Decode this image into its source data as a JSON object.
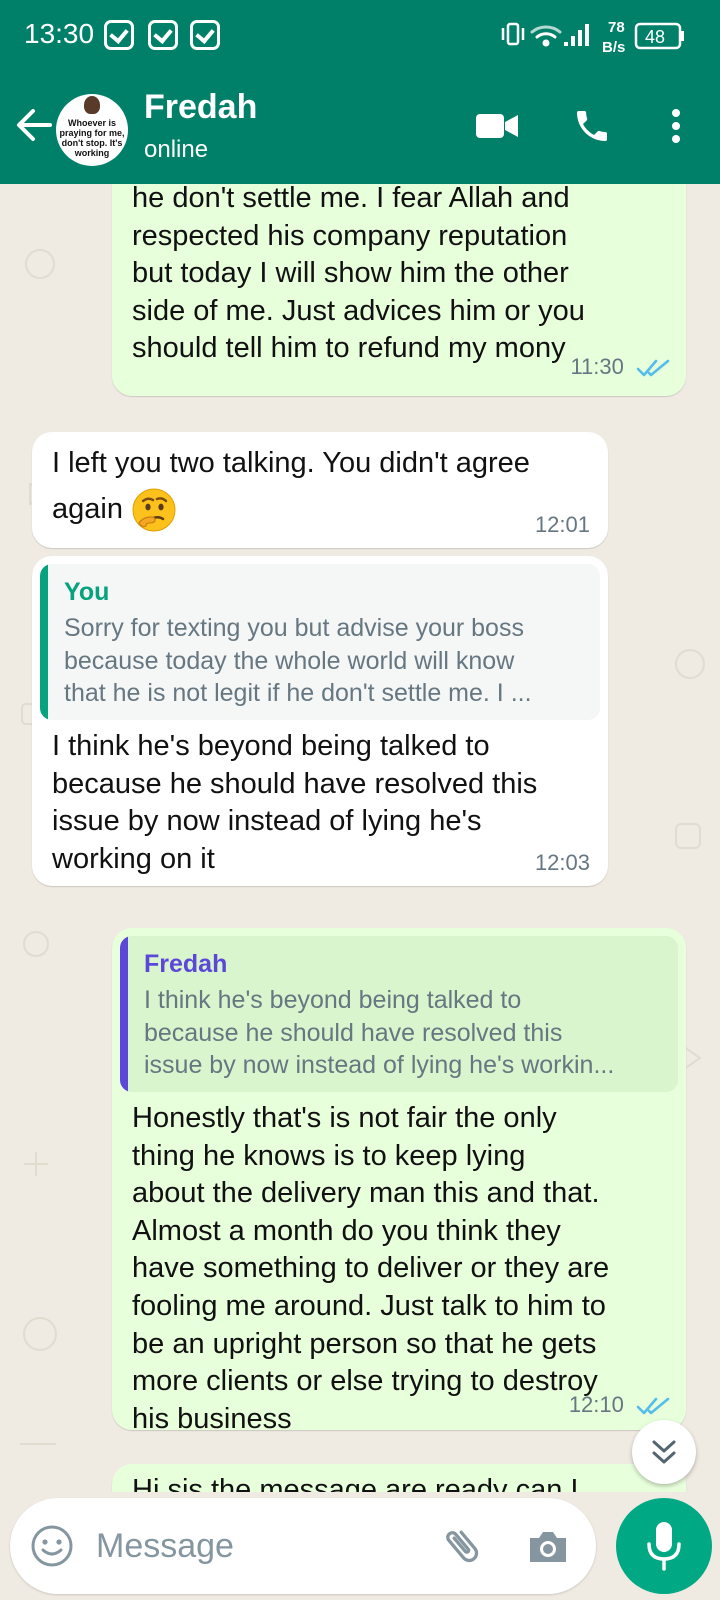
{
  "status_bar": {
    "time": "13:30",
    "network_speed_value": "78",
    "network_speed_unit": "B/s",
    "battery": "48"
  },
  "header": {
    "contact_name": "Fredah",
    "contact_status": "online",
    "avatar_text": "Whoever is praying for me, don't stop. It's working"
  },
  "messages": [
    {
      "direction": "outgoing",
      "lines": [
        "he don't settle me. I fear Allah and",
        "respected his company reputation",
        "but today I will show him the other",
        "side of me. Just advices him or you",
        "should tell him to refund my mony"
      ],
      "time": "11:30",
      "status": "read"
    },
    {
      "direction": "incoming",
      "lines": [
        "I left you two talking. You didn't agree",
        "again"
      ],
      "emoji": "thinking-face",
      "time": "12:01"
    },
    {
      "direction": "incoming",
      "quote": {
        "author": "You",
        "lines": [
          "Sorry for texting you but advise your boss",
          "because today the whole world will know",
          "that he is not legit if he don't settle me. I ..."
        ]
      },
      "lines": [
        "I think he's beyond being talked to",
        "because he should have resolved this",
        "issue by now instead of lying he's",
        "working on it"
      ],
      "time": "12:03"
    },
    {
      "direction": "outgoing",
      "quote": {
        "author": "Fredah",
        "lines": [
          "I think he's beyond being talked to",
          "because he should have resolved this",
          "issue by now instead of lying he's workin..."
        ]
      },
      "lines": [
        "Honestly that's is not fair the only",
        "thing he knows is to keep lying",
        "about the delivery man this and that.",
        "Almost a month do you think they",
        "have something to deliver or they are",
        "fooling me around. Just talk to him to",
        "be an upright person so that he gets",
        "more clients or else trying to destroy",
        "his business"
      ],
      "time": "12:10",
      "status": "read"
    },
    {
      "direction": "outgoing",
      "lines": [
        "Hi sis the message are ready can I"
      ]
    }
  ],
  "composer": {
    "placeholder": "Message"
  },
  "colors": {
    "header": "#008069",
    "chat_background": "#efeae2",
    "outgoing_bubble": "#e7ffdb",
    "incoming_bubble": "#ffffff",
    "read_ticks": "#53bdeb",
    "quote_you": "#06a37e",
    "quote_fredah": "#5b48d8",
    "mic_button": "#00a884"
  }
}
